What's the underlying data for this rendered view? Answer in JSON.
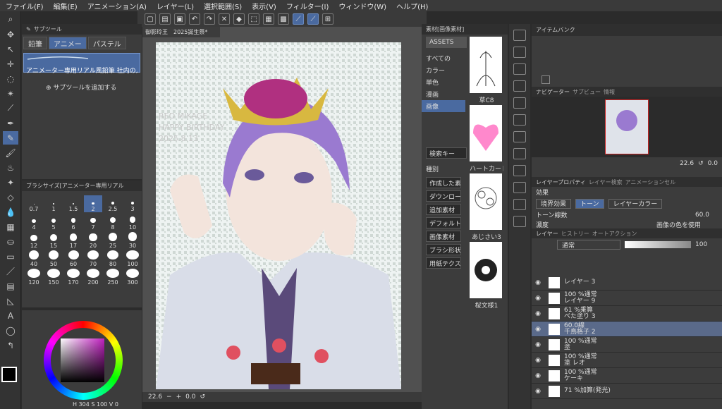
{
  "menu": [
    "ファイル(F)",
    "編集(E)",
    "アニメーション(A)",
    "レイヤー(L)",
    "選択範囲(S)",
    "表示(V)",
    "フィルター(I)",
    "ウィンドウ(W)",
    "ヘルプ(H)"
  ],
  "subtool": {
    "header": "サブツール",
    "tabs": [
      "鉛筆",
      "アニメー",
      "パステル"
    ],
    "selected_brush": "アニメーター専用リアル風鉛筆 社内の人",
    "add_label": "サブツールを追加する"
  },
  "brush_size": {
    "header": "ブラシサイズ[アニメーター専用リアル",
    "sizes": [
      "0.7",
      "1",
      "1.5",
      "2",
      "2.5",
      "3",
      "4",
      "5",
      "6",
      "7",
      "8",
      "10",
      "12",
      "15",
      "17",
      "20",
      "25",
      "30",
      "40",
      "50",
      "60",
      "70",
      "80",
      "100",
      "120",
      "150",
      "170",
      "200",
      "250",
      "300"
    ],
    "selected": "2"
  },
  "color": {
    "hsv": "H 304 S 100 V 0",
    "main": "#000000"
  },
  "canvas": {
    "doc_tab": "御影玲王　2025誕生祭*",
    "art_text_1": "REO MIKAGE",
    "art_text_2": "HAPPY BIRTHDAY",
    "art_text_3": "2025.8.13",
    "zoom": "22.6",
    "angle": "0.0"
  },
  "materials": {
    "header": "素材[画像素材]",
    "assets": "ASSETS",
    "tree": [
      "すべての",
      "カラー",
      "単色",
      "漫画",
      "画像"
    ],
    "search_placeholder": "検索キー",
    "category_label": "種別",
    "filters": [
      "作成した素",
      "ダウンロード",
      "追加素材",
      "デフォルト",
      "画像素材",
      "ブラシ形状",
      "用紙テクスチ"
    ],
    "thumbs": [
      "草C8",
      "ハートカード",
      "あじさい3",
      "桜文様1"
    ]
  },
  "item_bank": {
    "header": "アイテムバンク"
  },
  "navigator": {
    "tabs": [
      "ナビゲーター",
      "サブビュー",
      "情報"
    ],
    "zoom": "22.6",
    "angle": "0.0"
  },
  "layer_property": {
    "tabs": [
      "レイヤープロパティ",
      "レイヤー検索",
      "アニメーションセル"
    ],
    "effect_label": "効果",
    "effects": [
      "境界効果",
      "トーン",
      "レイヤーカラー"
    ],
    "tone_label": "トーン線数",
    "tone_value": "60.0",
    "density_label": "濃度",
    "density_value": "画像の色を使用"
  },
  "layers": {
    "tabs": [
      "レイヤー",
      "ヒストリー",
      "オートアクション"
    ],
    "blend": "通常",
    "opacity": "100",
    "items": [
      {
        "line1": "",
        "line2": "レイヤー 3"
      },
      {
        "line1": "100 %通常",
        "line2": "レイヤー 9"
      },
      {
        "line1": "61 %乗算",
        "line2": "べた塗り 3"
      },
      {
        "line1": "60.0線",
        "line2": "千鳥格子 2"
      },
      {
        "line1": "100 %通常",
        "line2": "塗"
      },
      {
        "line1": "100 %通常",
        "line2": "塗 レオ"
      },
      {
        "line1": "100 %通常",
        "line2": "ケーキ"
      },
      {
        "line1": "71 %加算(発光)",
        "line2": ""
      }
    ]
  }
}
